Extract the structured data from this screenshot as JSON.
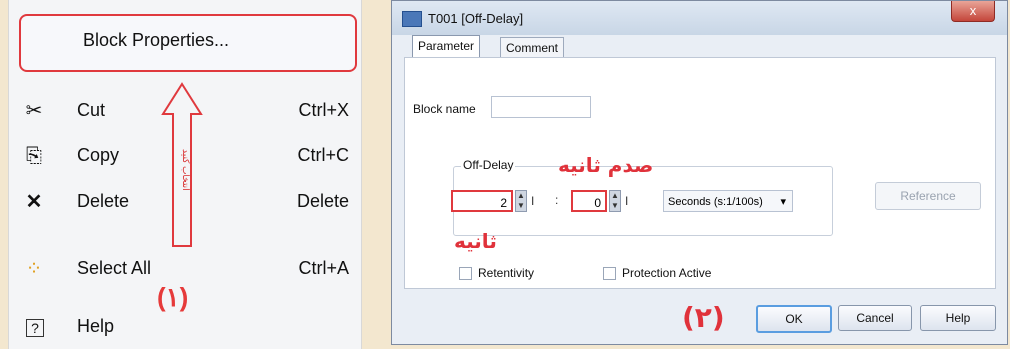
{
  "menu": {
    "block_properties": "Block Properties...",
    "arrow_note": "انتخاب کنید",
    "step_label": "(۱)",
    "items": [
      {
        "icon": "scissors-icon",
        "glyph": "✂",
        "label": "Cut",
        "shortcut": "Ctrl+X"
      },
      {
        "icon": "copy-icon",
        "glyph": "⎘",
        "label": "Copy",
        "shortcut": "Ctrl+C"
      },
      {
        "icon": "delete-x-icon",
        "glyph": "✕",
        "label": "Delete",
        "shortcut": "Delete"
      },
      {
        "icon": "select-all-icon",
        "glyph": "⁘",
        "label": "Select All",
        "shortcut": "Ctrl+A"
      },
      {
        "icon": "help-icon",
        "glyph": "?",
        "label": "Help",
        "shortcut": ""
      }
    ]
  },
  "dialog": {
    "title": "T001 [Off-Delay]",
    "close_label": "x",
    "tabs": [
      "Parameter",
      "Comment"
    ],
    "block_name_label": "Block name",
    "block_name_value": "",
    "off_delay_label": "Off-Delay",
    "seconds_value": "2",
    "hundredths_value": "0",
    "separator": ":",
    "units_value": "Seconds (s:1/100s)",
    "reference_label": "Reference",
    "retentivity_label": "Retentivity",
    "protection_label": "Protection Active",
    "ok_label": "OK",
    "cancel_label": "Cancel",
    "help_label": "Help",
    "annot_hundredths": "صدم ثانیه",
    "annot_seconds": "ثانیه",
    "step_label": "(۲)"
  },
  "colors": {
    "annotation_red": "#e0323b",
    "background": "#f3e7cf"
  }
}
